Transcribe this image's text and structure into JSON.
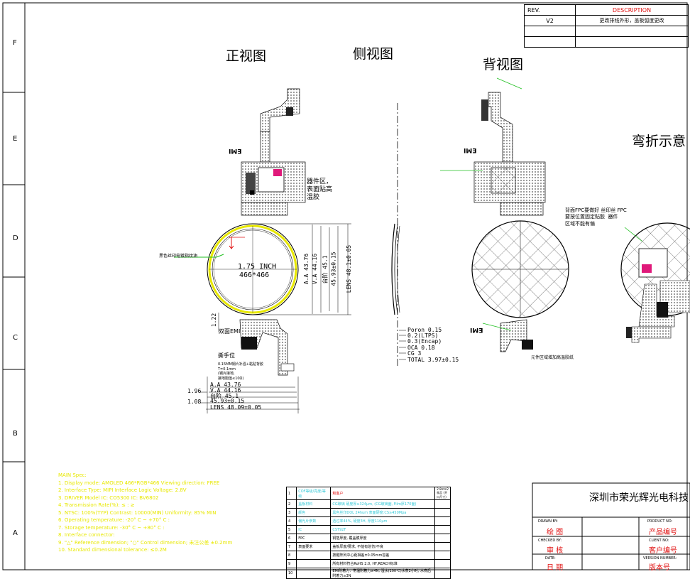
{
  "zones": [
    "F",
    "E",
    "D",
    "C",
    "B",
    "A"
  ],
  "revision_table": {
    "header_rev": "REV.",
    "header_desc": "DESCRIPTION",
    "rows": [
      {
        "rev": "V2",
        "desc": "更改排线外形，盖板弧度更改"
      }
    ]
  },
  "views": {
    "front": "正视图",
    "side": "侧视图",
    "back": "背视图",
    "bend": "弯折示意"
  },
  "front_labels": {
    "component_area": "器件区，\n表面贴高\n温胶",
    "size_inch": "1.75  INCH",
    "resolution": "466*466",
    "fingerprint_note": "黑色丝印电镀指纹油",
    "pull_tab": "撕手位",
    "steel_note": "0.15MM钢片补强+黏贴背胶\nT=0.1mm\n(钢片接地,\n接地阻值≤10Ω)",
    "fpc_text": "双面EMI",
    "top_emi": "EMI"
  },
  "dimensions": {
    "aa": "A.A 43.76",
    "va": "V.A 44.16",
    "step": "台阶 45.1",
    "outline": "45.93±0.15",
    "lens": "LENS 48.09±0.05",
    "left1": "1.96",
    "left2": "1.08",
    "v_aa": "A.A 43.76",
    "v_va": "V.A 44.16",
    "v_step": "台阶 45.1",
    "v_outline": "45.93±0.15",
    "v_lens": "LENS 48.1±0.05",
    "v_small": "1.22"
  },
  "side_stack": [
    "Poron 0.15",
    "0.2(LTPS)",
    "0.3(Encap)",
    "OCA 0.18",
    "CG 3",
    "TOTAL 3.97±0.15"
  ],
  "back_labels": {
    "fpc_note": "背面FPC要做好 丝印丝 FPC\n要按位置固定贴胶  器件\n区域不能有偏",
    "bottom_note": "元件区域增加高温胶纸",
    "emi": "EMI"
  },
  "yellow_notes": [
    "MAIN Spec:",
    "1. Display mode:      AMOLED 466*RGB*466  Viewing direction: FREE",
    "2. Interface Type:  MIPI Interface   Logic Voltage: 2.8V",
    "3. DRIVER Model IC:  CO5300          IC: BV6802",
    "4. Transmission Rate(%):    ≤ : ≥",
    "5. NTSC: 100%(TYP)  Contrast: 10000(MIN)  Uniformity: 85% MIN",
    "6. Operating temperature:  -20° C ~ +70° C :",
    "7. Storage temperature:  -30° C ~ +80° C :",
    "8. Interface connector:",
    "9. \"△\" Reference dimension; \"○\" Control dimension; 未注公差 ±0.2mm",
    "10. Standard dimensional tolerance: ≤0.2M"
  ],
  "spec_rows": [
    [
      "1",
      "COF等级/亮度/等级",
      "和客户",
      "2.8mm2样品 (开口尺寸)"
    ],
    [
      "2",
      "盖板材料",
      "CG玻璃 硬度厚≥324μm, (CG玻璃面, Film厚170面)",
      ""
    ],
    [
      "3",
      "颜色",
      "黑色丝印DOL 24hum 表面硬度:CS≥450Mpa",
      ""
    ],
    [
      "4",
      "偏光片参数",
      "透过率44%, 硬度3H, 厚度110μm",
      ""
    ],
    [
      "5",
      "IC",
      "CST92F",
      ""
    ],
    [
      "6",
      "FPC",
      "铜箔厚度, 覆盖膜厚度",
      ""
    ],
    [
      "7",
      "表面要求",
      "盖板厚度/要求, 不能有划伤/不良",
      ""
    ],
    [
      "8",
      "",
      "按键阵列中心距相差±0.05mm容差",
      ""
    ],
    [
      "9",
      "",
      "所有材料符合RoHS 2.0, HF,REACH标准",
      ""
    ],
    [
      "10",
      "",
      "EMI附着力：常温附着力≥4N, 湿水(100℃)水煮2小时, 水煮后附着力≥3N",
      ""
    ]
  ],
  "title_block": {
    "company": "深圳市荣光辉光电科技",
    "drawn_by_en": "DRAWN BY:",
    "drawn_by_cn": "绘 图",
    "checked_by_en": "CHECKED BY:",
    "checked_by_cn": "审 核",
    "date_en": "DATE:",
    "date_cn": "日 期",
    "product_no_en": "PRODUCT NO:",
    "product_no_cn": "产品编号",
    "client_no_en": "CLIENT NO:",
    "client_no_cn": "客户编号",
    "version_en": "VERSION NUMBER:",
    "version_cn": "版本号"
  },
  "colors": {
    "yellow": "#e8e800",
    "cyan": "#36c9d8",
    "red": "#e01010",
    "green_leader": "#1fbf1f",
    "pink": "#e0197a"
  }
}
